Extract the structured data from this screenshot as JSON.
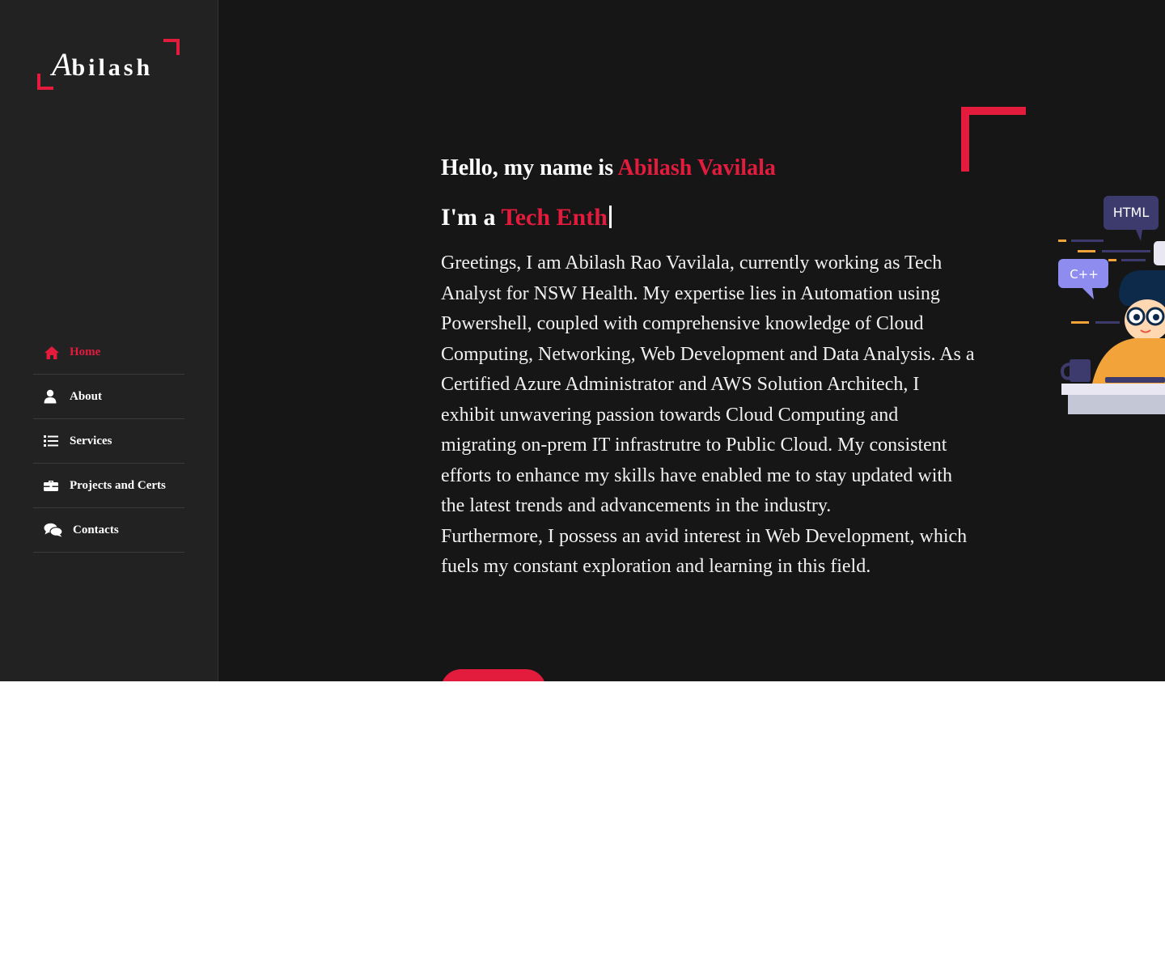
{
  "logo": {
    "first_letter": "A",
    "rest": "bilash"
  },
  "colors": {
    "accent": "#e31b3d",
    "background": "#161617",
    "sidebar": "#222223",
    "text": "#ffffff"
  },
  "nav": {
    "items": [
      {
        "label": "Home",
        "icon": "home-icon",
        "active": true
      },
      {
        "label": "About",
        "icon": "user-icon",
        "active": false
      },
      {
        "label": "Services",
        "icon": "list-icon",
        "active": false
      },
      {
        "label": "Projects and Certs",
        "icon": "briefcase-icon",
        "active": false
      },
      {
        "label": "Contacts",
        "icon": "comments-icon",
        "active": false
      }
    ]
  },
  "hero": {
    "greeting_prefix": "Hello, my name is ",
    "name": "Abilash Vavilala",
    "role_prefix": "I'm a ",
    "role_typed": "Tech Enth",
    "bio_paragraphs": [
      "Greetings, I am Abilash Rao Vavilala, currently working as Tech Analyst for NSW Health. My expertise lies in Automation using Powershell, coupled with comprehensive knowledge of Cloud Computing, Networking, Web Development and Data Analysis. As a Certified Azure Administrator and AWS Solution Architech, I exhibit unwavering passion towards Cloud Computing and migrating on-prem IT infrastrutre to Public Cloud. My consistent efforts to enhance my skills have enabled me to stay updated with the latest trends and advancements in the industry.",
      "Furthermore, I possess an avid interest in Web Development, which fuels my constant exploration and learning in this field."
    ],
    "cta_label": ""
  },
  "illustration": {
    "bubble_html": "HTML",
    "bubble_cpp": "C++"
  }
}
